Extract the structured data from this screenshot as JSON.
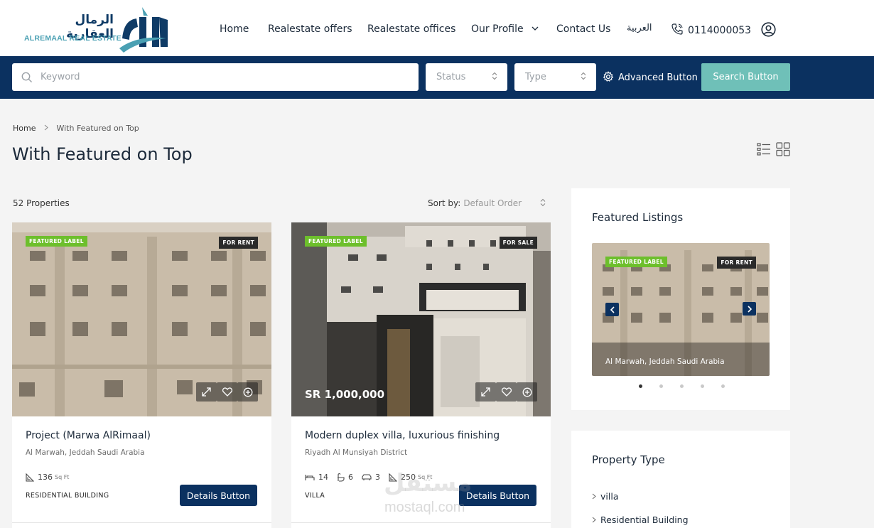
{
  "header": {
    "logo_ar": "الرمال العقارية",
    "logo_en": "ALREMAAL REAL ESTATE",
    "nav": [
      {
        "label": "Home"
      },
      {
        "label": "Realestate offers"
      },
      {
        "label": "Realestate offices"
      },
      {
        "label": "Our Profile"
      },
      {
        "label": "Contact Us"
      },
      {
        "label": "العربية"
      }
    ],
    "phone": "0114000053"
  },
  "search": {
    "keyword_placeholder": "Keyword",
    "status_label": "Status",
    "type_label": "Type",
    "advanced_label": "Advanced Button",
    "search_label": "Search Button"
  },
  "breadcrumb": {
    "home": "Home",
    "current": "With Featured on Top"
  },
  "page": {
    "title": "With Featured on Top",
    "count": "52 Properties",
    "sort_label": "Sort by:",
    "sort_value": "Default Order"
  },
  "listings": [
    {
      "featured_label": "FEATURED LABEL",
      "status": "FOR RENT",
      "price": "",
      "title": "Project (Marwa AlRimaal)",
      "address": "Al Marwah, Jeddah Saudi Arabia",
      "area": "136",
      "area_unit": "Sq Ft",
      "property_type": "RESIDENTIAL BUILDING",
      "details_label": "Details Button"
    },
    {
      "featured_label": "FEATURED LABEL",
      "status": "FOR SALE",
      "price": "SR 1,000,000",
      "title": "Modern duplex villa, luxurious finishing",
      "address": "Riyadh Al Munsiyah District",
      "beds": "14",
      "baths": "6",
      "garages": "3",
      "area": "250",
      "area_unit": "Sq Ft",
      "property_type": "VILLA",
      "details_label": "Details Button"
    }
  ],
  "sidebar": {
    "featured_title": "Featured Listings",
    "featured": {
      "featured_label": "FEATURED LABEL",
      "status": "FOR RENT",
      "address": "Al Marwah, Jeddah Saudi Arabia"
    },
    "property_type_title": "Property Type",
    "property_types": [
      "villa",
      "Residential Building"
    ]
  },
  "watermark": {
    "ar": "مستقل",
    "en": "mostaql.com"
  },
  "colors": {
    "navy": "#0b3160",
    "teal": "#6fc0b8",
    "featured_green": "#6dbf2c"
  }
}
